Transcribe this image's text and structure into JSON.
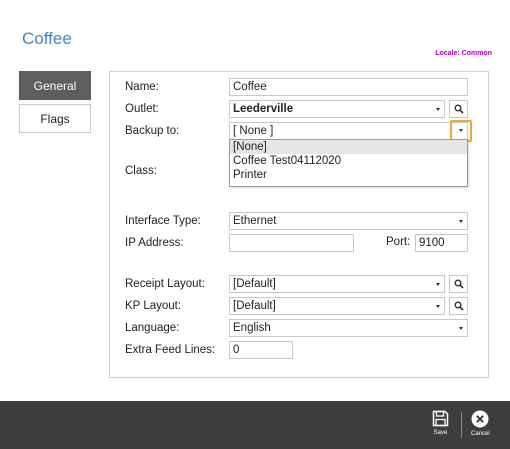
{
  "title": "Coffee",
  "locale": {
    "label": "Locale:",
    "value": "Common"
  },
  "tabs": [
    {
      "label": "General",
      "active": true
    },
    {
      "label": "Flags",
      "active": false
    }
  ],
  "form": {
    "name_label": "Name:",
    "name_value": "Coffee",
    "outlet_label": "Outlet:",
    "outlet_value": "Leederville",
    "backup_label": "Backup to:",
    "backup_value": "[ None ]",
    "class_label": "Class:",
    "interface_label": "Interface Type:",
    "interface_value": "Ethernet",
    "ip_label": "IP Address:",
    "ip_value": "",
    "port_label": "Port:",
    "port_value": "9100",
    "receipt_label": "Receipt Layout:",
    "receipt_value": "[Default]",
    "kp_label": "KP Layout:",
    "kp_value": "[Default]",
    "language_label": "Language:",
    "language_value": "English",
    "extra_label": "Extra Feed Lines:",
    "extra_value": "0"
  },
  "backup_dropdown": {
    "options": [
      "[None]",
      "Coffee Test04112020",
      "Printer"
    ],
    "selected_index": 0
  },
  "bottom_bar": {
    "save_label": "Save",
    "cancel_label": "Cancel"
  },
  "colors": {
    "title": "#3f86c9",
    "locale": "#b000c8",
    "highlight": "#f0a830",
    "bottom_bar": "#3e3e3e",
    "active_tab": "#5e5e5e"
  },
  "icons": {
    "lookup": "search-icon",
    "save": "floppy-disk-icon",
    "cancel": "close-circle-icon"
  }
}
